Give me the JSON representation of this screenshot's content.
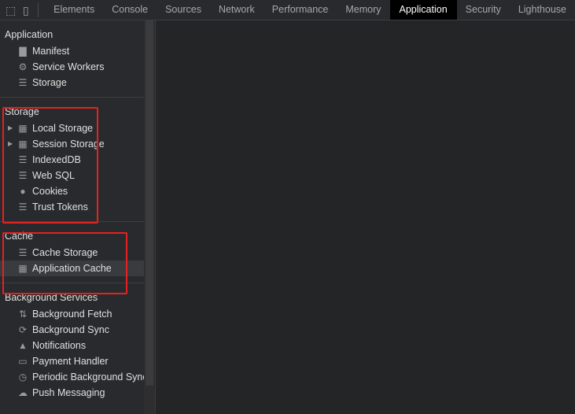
{
  "toolbar": {
    "tabs": [
      "Elements",
      "Console",
      "Sources",
      "Network",
      "Performance",
      "Memory",
      "Application",
      "Security",
      "Lighthouse"
    ],
    "active": "Application"
  },
  "sidebar": {
    "application": {
      "title": "Application",
      "items": [
        {
          "label": "Manifest",
          "icon": "file-icon"
        },
        {
          "label": "Service Workers",
          "icon": "gear-icon"
        },
        {
          "label": "Storage",
          "icon": "database-icon"
        }
      ]
    },
    "storage": {
      "title": "Storage",
      "items": [
        {
          "label": "Local Storage",
          "icon": "grid-icon"
        },
        {
          "label": "Session Storage",
          "icon": "grid-icon"
        },
        {
          "label": "IndexedDB",
          "icon": "database-icon"
        },
        {
          "label": "Web SQL",
          "icon": "database-icon"
        },
        {
          "label": "Cookies",
          "icon": "cookie-icon"
        },
        {
          "label": "Trust Tokens",
          "icon": "database-icon"
        }
      ]
    },
    "cache": {
      "title": "Cache",
      "items": [
        {
          "label": "Cache Storage",
          "icon": "database-icon"
        },
        {
          "label": "Application Cache",
          "icon": "grid-icon"
        }
      ]
    },
    "background": {
      "title": "Background Services",
      "items": [
        {
          "label": "Background Fetch",
          "icon": "up-down-arrows-icon"
        },
        {
          "label": "Background Sync",
          "icon": "sync-icon"
        },
        {
          "label": "Notifications",
          "icon": "bell-icon"
        },
        {
          "label": "Payment Handler",
          "icon": "card-icon"
        },
        {
          "label": "Periodic Background Sync",
          "icon": "clock-icon"
        },
        {
          "label": "Push Messaging",
          "icon": "cloud-icon"
        }
      ]
    }
  },
  "highlight_color": "#e52121"
}
